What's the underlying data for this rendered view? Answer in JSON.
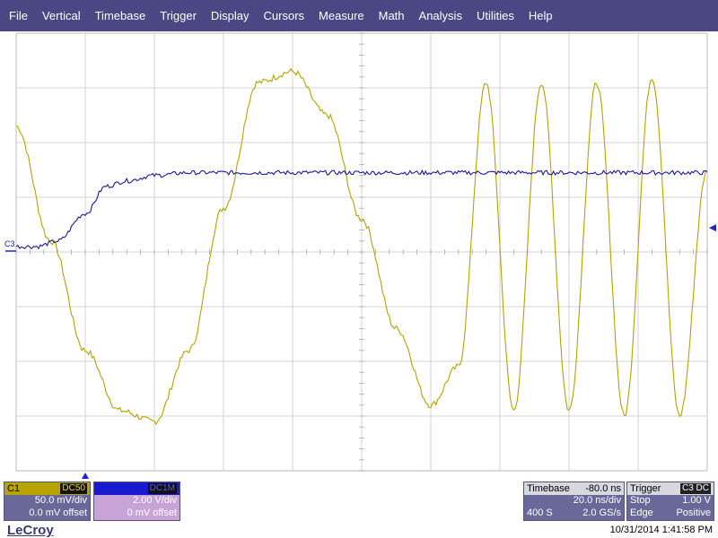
{
  "menu": [
    "File",
    "Vertical",
    "Timebase",
    "Trigger",
    "Display",
    "Cursors",
    "Measure",
    "Math",
    "Analysis",
    "Utilities",
    "Help"
  ],
  "colors": {
    "menu_bg": "#4b4784",
    "channel1": "#b5a300",
    "channel3": "#1a1a9a",
    "grid": "#c8c8c8",
    "trigger_marker": "#2020d0"
  },
  "markers": {
    "c3_label": "C3",
    "trigger_level_icon": "triangle-left-icon",
    "trigger_position_icon": "triangle-up-icon"
  },
  "channel1": {
    "label": "C1",
    "coupling": "DC50",
    "scale": "50.0 mV/div",
    "offset": "0.0 mV offset"
  },
  "channel3": {
    "label": "C3",
    "coupling": "DC1M",
    "scale": "2.00 V/div",
    "offset": "0 mV offset"
  },
  "timebase": {
    "label": "Timebase",
    "delay": "-80.0 ns",
    "scale": "20.0 ns/div",
    "samples": "400 S",
    "rate": "2.0 GS/s"
  },
  "trigger": {
    "label": "Trigger",
    "source": "C3 DC",
    "mode": "Stop",
    "level": "1.00 V",
    "type": "Edge",
    "slope": "Positive"
  },
  "brand": "LeCroy",
  "timestamp": "10/31/2014 1:41:58 PM",
  "chart_data": {
    "type": "line",
    "grid": {
      "x_divisions": 10,
      "y_divisions": 8,
      "show": true
    },
    "x_range_divisions": [
      0,
      10
    ],
    "y_range_divisions": [
      -4,
      4
    ],
    "series": [
      {
        "name": "C1",
        "color": "#b5a300",
        "x_div": [
          0,
          0.5,
          1,
          1.5,
          2,
          2.5,
          3,
          3.5,
          4,
          4.5,
          5,
          5.5,
          6,
          6.4,
          6.8,
          7.2,
          7.6,
          8,
          8.4,
          8.8,
          9.2,
          9.6,
          10
        ],
        "y_div": [
          2.3,
          0.2,
          -1.8,
          -2.9,
          -3.1,
          -1.8,
          0.8,
          3.1,
          3.3,
          2.5,
          0.6,
          -1.4,
          -2.8,
          -2.1,
          3.1,
          -2.9,
          3.1,
          -2.9,
          3.1,
          -3.0,
          3.2,
          -3.0,
          1.5
        ]
      },
      {
        "name": "C3",
        "color": "#1a1a9a",
        "x_div": [
          0,
          0.3,
          0.6,
          1,
          1.3,
          1.6,
          2,
          2.5,
          3,
          4,
          5,
          6,
          7,
          8,
          9,
          10
        ],
        "y_div": [
          0.1,
          0.1,
          0.2,
          0.7,
          1.2,
          1.3,
          1.4,
          1.45,
          1.45,
          1.45,
          1.45,
          1.45,
          1.45,
          1.45,
          1.45,
          1.45
        ]
      }
    ]
  }
}
